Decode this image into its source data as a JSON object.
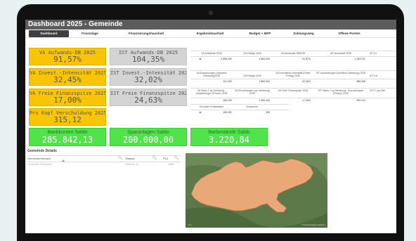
{
  "title": "Dashboard 2025 - Gemeinde",
  "tabs": [
    "Dashboard",
    "Finanzlage",
    "Finanzierungshaushalt",
    "Ergebnishaushalt",
    "Budget + MFP",
    "Zahlungsweg",
    "Offene Posten"
  ],
  "kpis": {
    "va_aufwands": {
      "label": "VA Aufwands-DB 2025",
      "value": "91,57%"
    },
    "ist_aufwands": {
      "label": "IST Aufwands-DB 2025",
      "value": "104,35%"
    },
    "va_invest": {
      "label": "VA Invest.-Intensität 2025",
      "value": "32,45%"
    },
    "ist_invest": {
      "label": "IST Invest.-Intensität 2025",
      "value": "32,02%"
    },
    "va_spitze": {
      "label": "VA Freie Finanzspitze 2025",
      "value": "17,00%"
    },
    "ist_spitze": {
      "label": "IST Freie Finanzspitze 2025",
      "value": "24,63%"
    },
    "pro_kopf": {
      "label": "Pro Kopf Verschuldung 2025",
      "value": "315,12"
    },
    "bankkonten": {
      "label": "Bankkonten Saldo",
      "value": "285.842,13"
    },
    "sparanlagen": {
      "label": "Sparanlagen Saldo",
      "value": "200.000,00"
    },
    "barbestand": {
      "label": "Barbestände Saldo",
      "value": "3.220,84"
    }
  },
  "table": {
    "row1_labels": [
      "VA Aufwände 2025",
      "VA Erträge 2025",
      "VA Aufwands-DB2025",
      "IST Aufwände 2025",
      "IST Er"
    ],
    "row1_values": [
      "2.858.400",
      "1.884.000",
      "91,57%",
      "1.153.231"
    ],
    "row2_labels": [
      "VA Auszahlungen (Investive Gebarung)2025",
      "VA Erträge 2025",
      "VA Investitions-Intensität (Erster Ertrag) 2025",
      "IST Auszahlungen (Investive Gebarung) 2025",
      "IST Ert"
    ],
    "row2_values": [
      "611.000",
      "1.884.000",
      "32,45%",
      "385.368"
    ],
    "row3_labels": [
      "VA Saldo 1 op.Gebarung - Auszahlungen (Finanz) 2025",
      "VA Einzahlungen (op.Gebarung) 2025",
      "VA Freie Finanzspitze 2025",
      "IST Saldo 1 op.Gebarung - Auszahlungen (Finanz) 2025",
      "IST E (op.Geb"
    ],
    "row3_values": [
      "266.200",
      "1.565.400",
      "17,00%",
      "300.413"
    ],
    "row4_labels": [
      "Schulden Endbestand",
      "Einwohner"
    ],
    "row4_values": [
      "106.300",
      "406"
    ]
  },
  "details": {
    "title": "Gemeinde Details",
    "col1": "GemeindeVerband",
    "col2": "Strasse",
    "col3": "PLZ",
    "row": [
      "Gemeinde Schnepfau",
      "Hirschau 10",
      "6882"
    ]
  },
  "map": {
    "scale": "1 km",
    "credit": "© OpenStreetMap contributors"
  },
  "colors": {
    "yellow": "#f8c500",
    "gray": "#d4d4d4",
    "green": "#50e34a",
    "map_fill": "#e8a878",
    "map_bg": "#5c7a49"
  }
}
